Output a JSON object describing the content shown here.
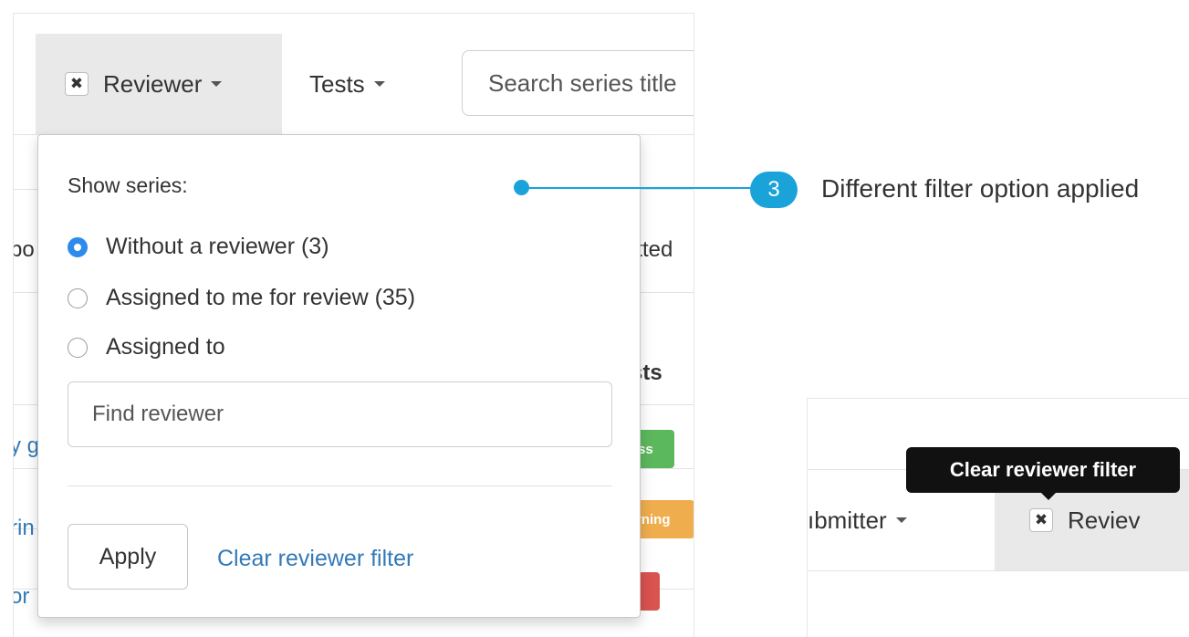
{
  "toolbar": {
    "reviewer_label": "Reviewer",
    "tests_label": "Tests",
    "search_placeholder": "Search series title"
  },
  "background_fragments": {
    "row1_left": "po",
    "row1_right": "itted",
    "header_right": "sts",
    "row2_left": "y g",
    "row3_left": "rin",
    "row4_left": "or",
    "badge_success": "ss",
    "badge_warning": "rning"
  },
  "dropdown": {
    "heading": "Show series:",
    "options": [
      {
        "label": "Without a reviewer (3)",
        "selected": true
      },
      {
        "label": "Assigned to me for review (35)",
        "selected": false
      },
      {
        "label": "Assigned to",
        "selected": false
      }
    ],
    "find_placeholder": "Find reviewer",
    "apply_label": "Apply",
    "clear_label": "Clear reviewer filter"
  },
  "callout": {
    "number": "3",
    "text": "Different filter option applied"
  },
  "inset": {
    "submitter_label": "ıbmitter",
    "reviewer_label": "Reviev",
    "tooltip": "Clear reviewer filter"
  },
  "colors": {
    "accent": "#1aa3d9",
    "link": "#337ab7",
    "radio_selected": "#2d8ceb",
    "success": "#5cb85c",
    "warning": "#f0ad4e",
    "danger": "#d9534f",
    "active_tab": "#e9e9e9"
  }
}
